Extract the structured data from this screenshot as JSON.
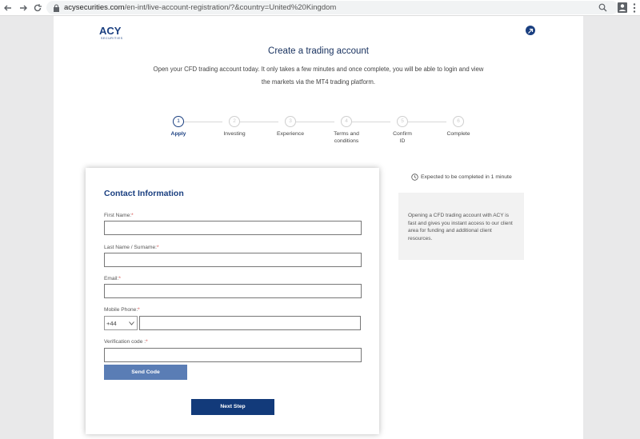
{
  "browser": {
    "url_domain": "acysecurities.com",
    "url_path": "/en-int/live-account-registration/?&country=United%20Kingdom"
  },
  "header": {
    "logo_text": "ACY",
    "logo_subtext": "SECURITIES"
  },
  "main": {
    "title": "Create a trading account",
    "intro": "Open your CFD trading account today. It only takes a few minutes and once complete, you will be able to login and view the markets via the MT4 trading platform."
  },
  "stepper": {
    "steps": [
      {
        "number": "1",
        "label": "Apply",
        "active": true
      },
      {
        "number": "2",
        "label": "Investing",
        "active": false
      },
      {
        "number": "3",
        "label": "Experience",
        "active": false
      },
      {
        "number": "4",
        "label": "Terms and conditions",
        "active": false
      },
      {
        "number": "5",
        "label": "Confirm ID",
        "active": false
      },
      {
        "number": "6",
        "label": "Complete",
        "active": false
      }
    ]
  },
  "form": {
    "title": "Contact Information",
    "first_name_label": "First Name:",
    "last_name_label": "Last Name / Surname:",
    "email_label": "Email:",
    "mobile_label": "Mobile Phone:",
    "country_code": "+44",
    "verification_label": "Verification code :",
    "required_mark": "*",
    "send_code_label": "Send Code",
    "next_step_label": "Next Step"
  },
  "sidebar": {
    "expect_text": "Expected to be completed in 1 minute",
    "info_text": "Opening a CFD trading account with ACY is fast and gives you instant access to our client area for funding and additional client resources."
  },
  "colors": {
    "brand": "#1a3f80",
    "send_code_bg": "#5a7db5",
    "next_step_bg": "#123a7a",
    "required": "#d9534f"
  }
}
